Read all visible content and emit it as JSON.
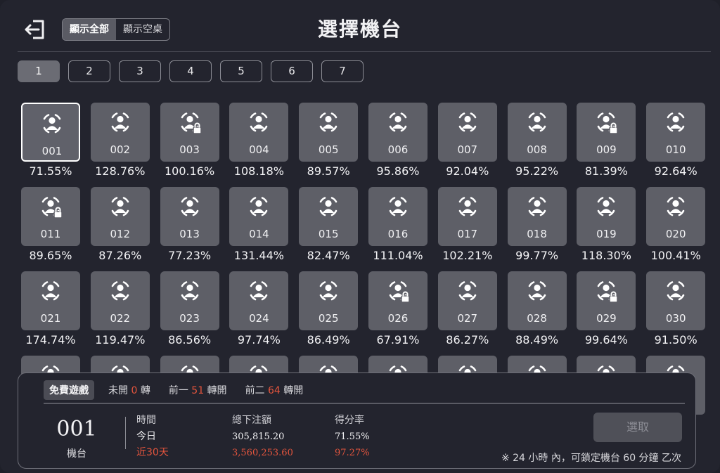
{
  "header": {
    "title": "選擇機台",
    "filters": [
      {
        "label": "顯示全部",
        "active": true
      },
      {
        "label": "顯示空桌",
        "active": false
      }
    ]
  },
  "pages": [
    {
      "label": "1",
      "active": true
    },
    {
      "label": "2",
      "active": false
    },
    {
      "label": "3",
      "active": false
    },
    {
      "label": "4",
      "active": false
    },
    {
      "label": "5",
      "active": false
    },
    {
      "label": "6",
      "active": false
    },
    {
      "label": "7",
      "active": false
    }
  ],
  "machines": [
    {
      "no": "001",
      "rate": "71.55%",
      "locked": false,
      "selected": true
    },
    {
      "no": "002",
      "rate": "128.76%",
      "locked": false
    },
    {
      "no": "003",
      "rate": "100.16%",
      "locked": true
    },
    {
      "no": "004",
      "rate": "108.18%",
      "locked": false
    },
    {
      "no": "005",
      "rate": "89.57%",
      "locked": false
    },
    {
      "no": "006",
      "rate": "95.86%",
      "locked": false
    },
    {
      "no": "007",
      "rate": "92.04%",
      "locked": false
    },
    {
      "no": "008",
      "rate": "95.22%",
      "locked": false
    },
    {
      "no": "009",
      "rate": "81.39%",
      "locked": true
    },
    {
      "no": "010",
      "rate": "92.64%",
      "locked": false
    },
    {
      "no": "011",
      "rate": "89.65%",
      "locked": true
    },
    {
      "no": "012",
      "rate": "87.26%",
      "locked": false
    },
    {
      "no": "013",
      "rate": "77.23%",
      "locked": false
    },
    {
      "no": "014",
      "rate": "131.44%",
      "locked": false
    },
    {
      "no": "015",
      "rate": "82.47%",
      "locked": false
    },
    {
      "no": "016",
      "rate": "111.04%",
      "locked": false
    },
    {
      "no": "017",
      "rate": "102.21%",
      "locked": false
    },
    {
      "no": "018",
      "rate": "99.77%",
      "locked": false
    },
    {
      "no": "019",
      "rate": "118.30%",
      "locked": false
    },
    {
      "no": "020",
      "rate": "100.41%",
      "locked": false
    },
    {
      "no": "021",
      "rate": "174.74%",
      "locked": false
    },
    {
      "no": "022",
      "rate": "119.47%",
      "locked": false
    },
    {
      "no": "023",
      "rate": "86.56%",
      "locked": false
    },
    {
      "no": "024",
      "rate": "97.74%",
      "locked": false
    },
    {
      "no": "025",
      "rate": "86.49%",
      "locked": false
    },
    {
      "no": "026",
      "rate": "67.91%",
      "locked": true
    },
    {
      "no": "027",
      "rate": "86.27%",
      "locked": false
    },
    {
      "no": "028",
      "rate": "88.49%",
      "locked": false
    },
    {
      "no": "029",
      "rate": "99.64%",
      "locked": true
    },
    {
      "no": "030",
      "rate": "91.50%",
      "locked": false
    }
  ],
  "panel": {
    "free_game_label": "免費遊戲",
    "stats": [
      {
        "prefix": "未開 ",
        "value": "0",
        "suffix": " 轉"
      },
      {
        "prefix": "前一 ",
        "value": "51",
        "suffix": " 轉開"
      },
      {
        "prefix": "前二 ",
        "value": "64",
        "suffix": " 轉開"
      }
    ],
    "machine_no": "001",
    "machine_label": "機台",
    "table": {
      "col_time": "時間",
      "col_bet": "總下注額",
      "col_rate": "得分率",
      "row1": {
        "time": "今日",
        "bet": "305,815.20",
        "rate": "71.55%"
      },
      "row2": {
        "time": "近30天",
        "bet": "3,560,253.60",
        "rate": "97.27%"
      }
    },
    "select_label": "選取",
    "note": "※ 24 小時 內，可鎖定機台 60 分鐘 乙次"
  },
  "colors": {
    "accent": "#e5553d",
    "tile": "#5e5f67",
    "background": "#23242e"
  }
}
